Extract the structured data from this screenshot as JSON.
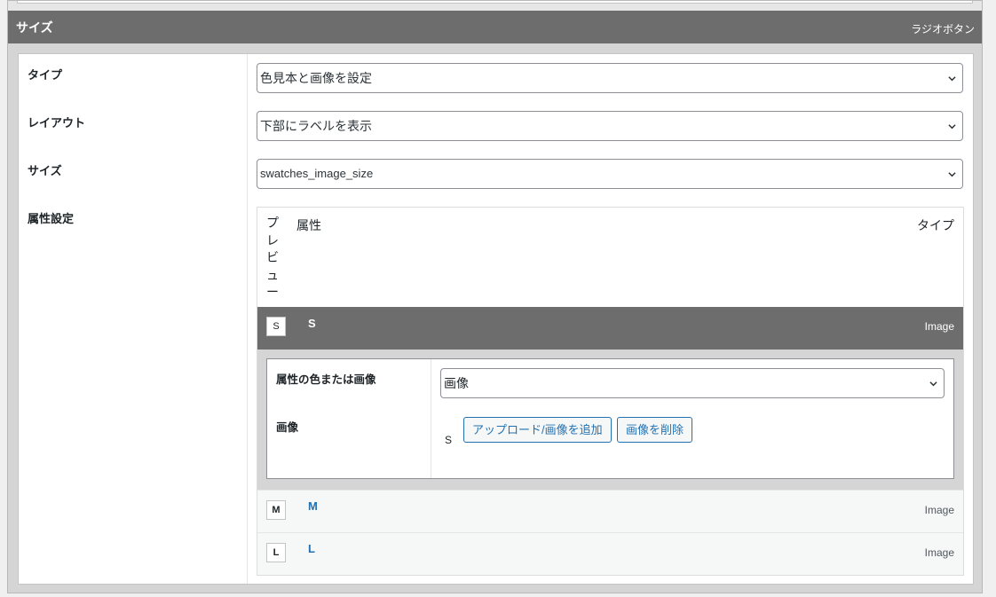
{
  "section": {
    "title": "サイズ",
    "type": "ラジオボタン"
  },
  "fields": {
    "type": {
      "label": "タイプ",
      "value": "色見本と画像を設定"
    },
    "layout": {
      "label": "レイアウト",
      "value": "下部にラベルを表示"
    },
    "size": {
      "label": "サイズ",
      "value": "swatches_image_size"
    },
    "attributes": {
      "label": "属性設定"
    }
  },
  "table": {
    "headers": {
      "preview": "プレビュー",
      "attribute": "属性",
      "type": "タイプ"
    },
    "rows": [
      {
        "preview": "S",
        "name": "S",
        "type": "Image",
        "detail": {
          "color_or_image_label": "属性の色または画像",
          "color_or_image_value": "画像",
          "image_label": "画像",
          "image_value": "S",
          "upload_button": "アップロード/画像を追加",
          "remove_button": "画像を削除"
        }
      },
      {
        "preview": "M",
        "name": "M",
        "type": "Image"
      },
      {
        "preview": "L",
        "name": "L",
        "type": "Image"
      }
    ]
  }
}
